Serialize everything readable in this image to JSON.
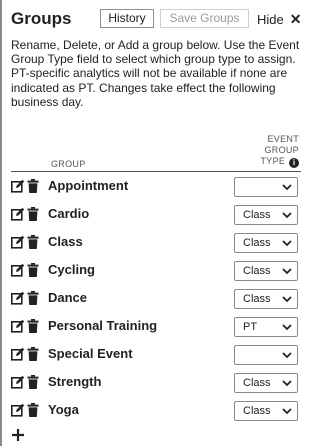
{
  "panel": {
    "title": "Groups",
    "history_label": "History",
    "save_label": "Save Groups",
    "hide_label": "Hide",
    "close_symbol": "✕",
    "description": "Rename, Delete, or Add a group below. Use the Event Group Type field to select which group type to assign. PT-specific analytics will not be available if none are indicated as PT. Changes take effect the following business day."
  },
  "table": {
    "col_group": "GROUP",
    "col_type_line1": "EVENT",
    "col_type_line2": "GROUP",
    "col_type_line3": "TYPE",
    "info_symbol": "i",
    "rows": [
      {
        "name": "Appointment",
        "type": ""
      },
      {
        "name": "Cardio",
        "type": "Class"
      },
      {
        "name": "Class",
        "type": "Class"
      },
      {
        "name": "Cycling",
        "type": "Class"
      },
      {
        "name": "Dance",
        "type": "Class"
      },
      {
        "name": "Personal Training",
        "type": "PT"
      },
      {
        "name": "Special Event",
        "type": ""
      },
      {
        "name": "Strength",
        "type": "Class"
      },
      {
        "name": "Yoga",
        "type": "Class"
      }
    ]
  },
  "icons": {
    "edit": "edit-icon",
    "delete": "trash-icon",
    "add": "plus-icon",
    "dropdown": "chevron-down-icon"
  }
}
